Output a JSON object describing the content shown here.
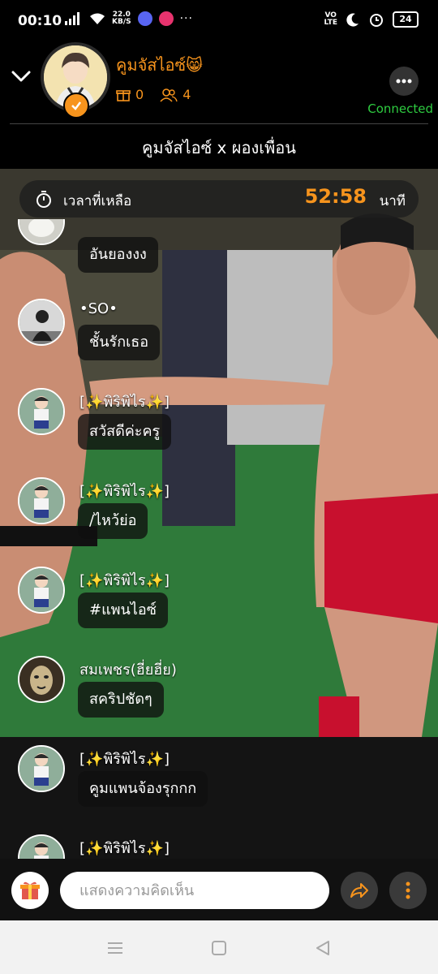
{
  "status_bar": {
    "time": "00:10",
    "net_speed_value": "22.0",
    "net_speed_unit": "KB/S",
    "volte_top": "VO",
    "volte_bottom": "LTE",
    "battery": "24",
    "more": "···"
  },
  "header": {
    "host_name": "คูมจัสไอซ์",
    "host_emoji": "😸",
    "gift_count": "0",
    "follower_count": "4",
    "connection_status": "Connected"
  },
  "room": {
    "title": "คูมจัสไอซ์ x ผองเพื่อน"
  },
  "timer": {
    "label": "เวลาที่เหลือ",
    "value": "52:58",
    "unit": "นาที"
  },
  "messages": [
    {
      "name": "",
      "text": "อันยองงง"
    },
    {
      "name": "•SO•",
      "text": "ชั้นรักเธอ"
    },
    {
      "name": "[✨พิริพิไร✨]",
      "text": "สวัสดีค่ะครู"
    },
    {
      "name": "[✨พิริพิไร✨]",
      "text": "/ไหว้ย่อ"
    },
    {
      "name": "[✨พิริพิไร✨]",
      "text": "#แพนไอซ์"
    },
    {
      "name": "สมเพชร(ฮี่ยฮี่ย)",
      "text": "สคริปชัดๆ"
    },
    {
      "name": "[✨พิริพิไร✨]",
      "text": "คูมแพนจ้องรุกกก"
    },
    {
      "name": "[✨พิริพิไร✨]",
      "text": ""
    }
  ],
  "input": {
    "placeholder": "แสดงความคิดเห็น"
  },
  "colors": {
    "accent": "#f7941d",
    "connected": "#2ecc40",
    "background": "#000000"
  }
}
